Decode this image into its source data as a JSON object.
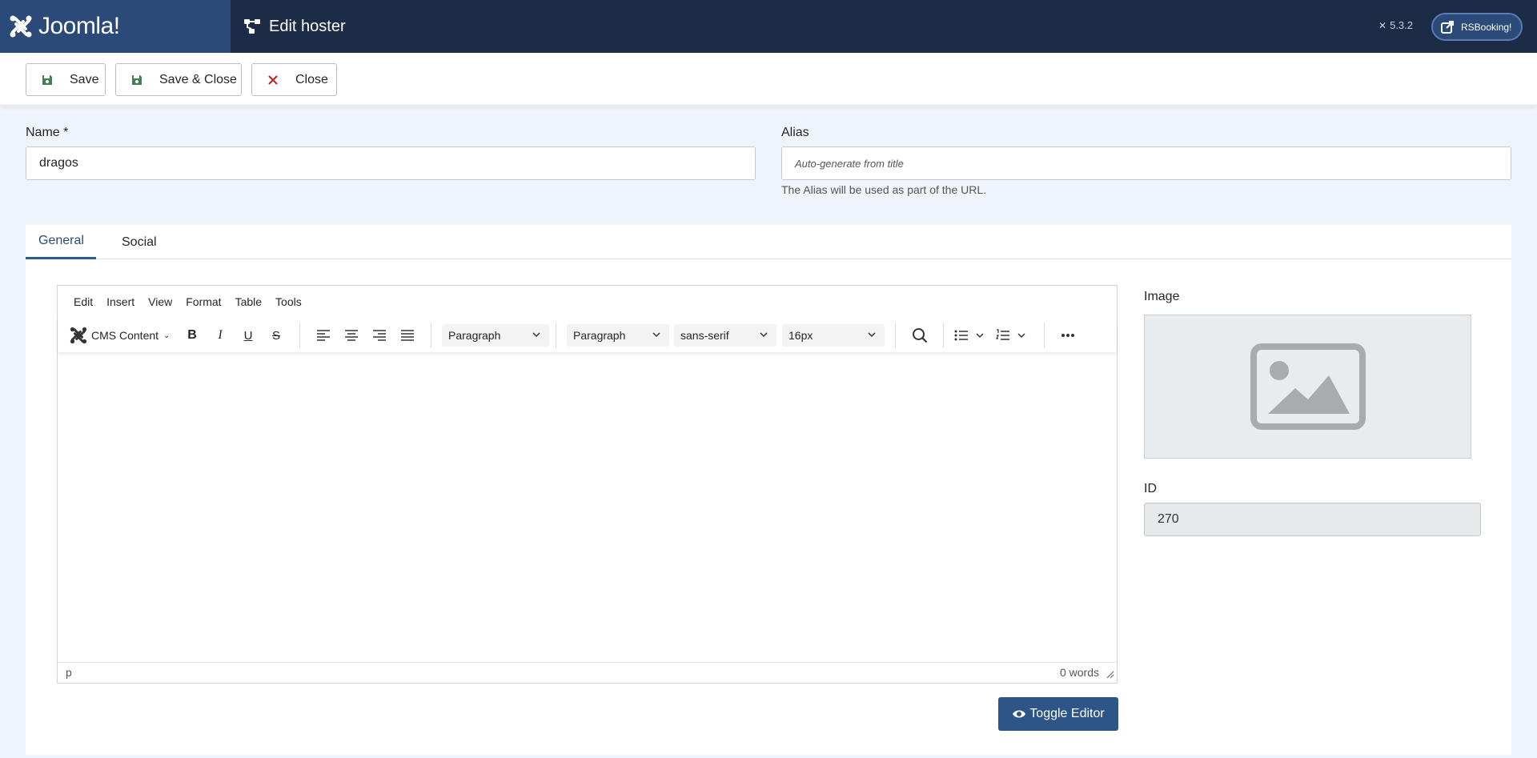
{
  "header": {
    "logo_text": "Joomla!",
    "page_title": "Edit hoster",
    "version": "5.3.2",
    "site_button_label": "RSBooking!"
  },
  "toolbar": {
    "save_label": "Save",
    "save_close_label": "Save & Close",
    "close_label": "Close"
  },
  "form": {
    "name_label": "Name *",
    "name_value": "dragos",
    "alias_label": "Alias",
    "alias_placeholder": "Auto-generate from title",
    "alias_help": "The Alias will be used as part of the URL."
  },
  "tabs": [
    {
      "label": "General",
      "active": true
    },
    {
      "label": "Social",
      "active": false
    }
  ],
  "editor": {
    "menu": [
      "Edit",
      "Insert",
      "View",
      "Format",
      "Table",
      "Tools"
    ],
    "cms_content_label": "CMS Content",
    "block_format": "Paragraph",
    "style_format": "Paragraph",
    "font_family": "sans-serif",
    "font_size": "16px",
    "status_path": "p",
    "word_count": "0 words",
    "toggle_label": "Toggle Editor"
  },
  "sidebar": {
    "image_label": "Image",
    "id_label": "ID",
    "id_value": "270"
  },
  "colors": {
    "header_bg": "#1c2b46",
    "logo_bg": "#2c4a79",
    "primary_btn": "#2d5588",
    "save_icon": "#457d54",
    "close_icon": "#c52827"
  }
}
